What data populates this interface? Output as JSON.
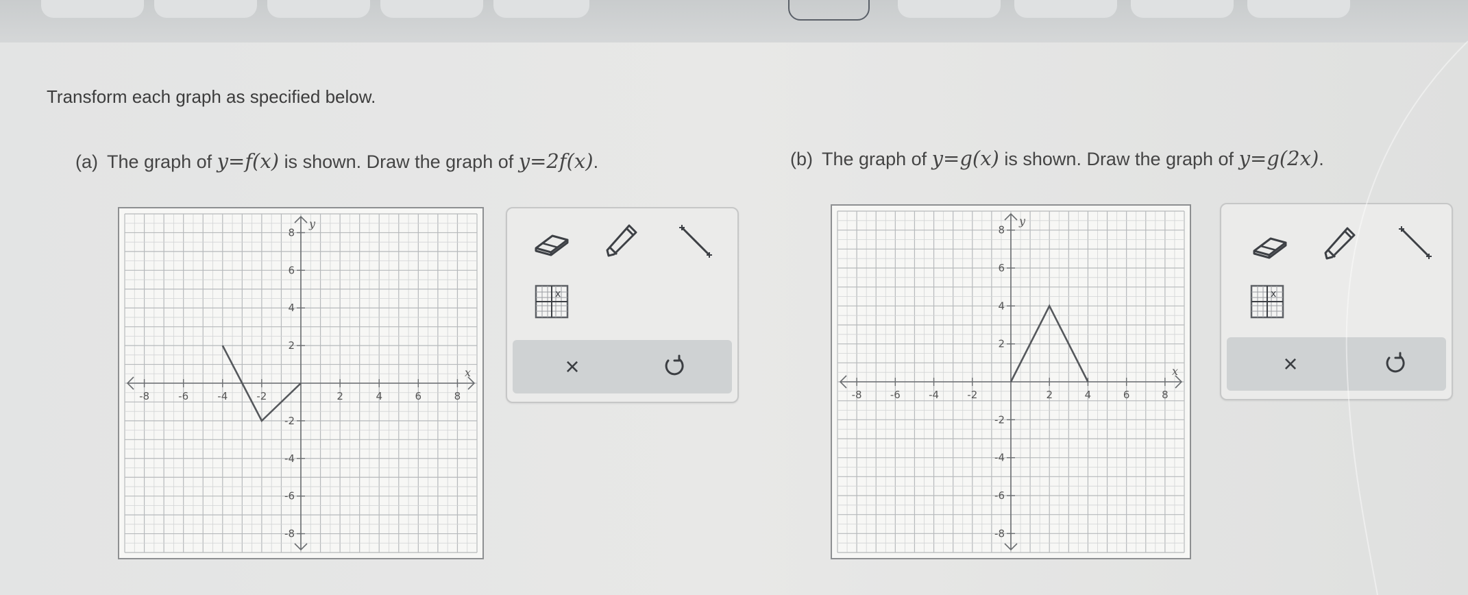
{
  "instructions": "Transform each graph as specified below.",
  "part_a": {
    "prefix": "(a)",
    "text_1": "The graph of",
    "given_eq": "y=f(x)",
    "text_2": "is shown. Draw the graph of",
    "target_eq": "y=2f(x)",
    "end": "."
  },
  "part_b": {
    "prefix": "(b)",
    "text_1": "The graph of",
    "given_eq": "y=g(x)",
    "text_2": "is shown. Draw the graph of",
    "target_eq": "y=g(2x)",
    "end": "."
  },
  "axis_labels": {
    "x": "x",
    "y": "y"
  },
  "x_ticks": [
    "-8",
    "-6",
    "-4",
    "-2",
    "2",
    "4",
    "6",
    "8"
  ],
  "y_ticks": [
    "8",
    "6",
    "4",
    "2",
    "-2",
    "-4",
    "-6",
    "-8"
  ],
  "tools": {
    "eraser": "eraser-icon",
    "pencil": "pencil-icon",
    "line": "line-segment-icon",
    "grid": "grid-toggle-icon",
    "clear": "×",
    "undo": "undo-icon"
  },
  "chart_data": [
    {
      "type": "line",
      "title": "",
      "xlabel": "x",
      "ylabel": "y",
      "xlim": [
        -9,
        9
      ],
      "ylim": [
        -9,
        9
      ],
      "grid": true,
      "series": [
        {
          "x": [
            -4,
            -2,
            0
          ],
          "y": [
            2,
            -2,
            0
          ]
        }
      ]
    },
    {
      "type": "line",
      "title": "",
      "xlabel": "x",
      "ylabel": "y",
      "xlim": [
        -9,
        9
      ],
      "ylim": [
        -9,
        9
      ],
      "grid": true,
      "series": [
        {
          "x": [
            0,
            2,
            4
          ],
          "y": [
            0,
            4,
            0
          ]
        }
      ]
    }
  ],
  "colors": {
    "graph_line": "#55585c",
    "grid_minor": "#d2d4d5",
    "grid_major": "#b6b9bb",
    "axis": "#6a6d70",
    "panel": "#ebebea",
    "action_bar": "#cfd2d3"
  }
}
